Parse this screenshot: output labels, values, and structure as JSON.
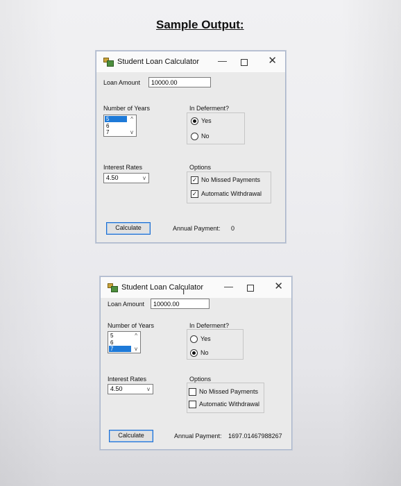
{
  "heading": "Sample Output:",
  "windows": [
    {
      "title": "Student Loan Calculator",
      "controls": {
        "minimize": "—",
        "maximize": "",
        "close": "✕"
      },
      "loan_amount_label": "Loan Amount",
      "loan_amount_value": "10000.00",
      "years_label": "Number of Years",
      "years_items": [
        "5",
        "6",
        "7"
      ],
      "years_selected": "5",
      "scroll_up": "^",
      "scroll_down": "v",
      "deferment_label": "In Deferment?",
      "deferment_yes": "Yes",
      "deferment_no": "No",
      "deferment_selected": "Yes",
      "rates_label": "Interest Rates",
      "rates_value": "4.50",
      "dropdown_arrow": "v",
      "options_label": "Options",
      "option_no_missed": "No Missed Payments",
      "option_auto": "Automatic Withdrawal",
      "option_no_missed_checked": true,
      "option_auto_checked": true,
      "calculate_label": "Calculate",
      "annual_payment_label": "Annual Payment:",
      "annual_payment_value": "0"
    },
    {
      "title": "Student Loan Calculator",
      "controls": {
        "minimize": "—",
        "maximize": "",
        "close": "✕"
      },
      "loan_amount_label": "Loan Amount",
      "loan_amount_value": "10000.00",
      "years_label": "Number of Years",
      "years_items": [
        "5",
        "6",
        "7"
      ],
      "years_selected": "7",
      "scroll_up": "^",
      "scroll_down": "v",
      "deferment_label": "In Deferment?",
      "deferment_yes": "Yes",
      "deferment_no": "No",
      "deferment_selected": "No",
      "rates_label": "Interest Rates",
      "rates_value": "4.50",
      "dropdown_arrow": "v",
      "options_label": "Options",
      "option_no_missed": "No Missed Payments",
      "option_auto": "Automatic Withdrawal",
      "option_no_missed_checked": false,
      "option_auto_checked": false,
      "calculate_label": "Calculate",
      "annual_payment_label": "Annual Payment:",
      "annual_payment_value": "1697.01467988267"
    }
  ],
  "colors": {
    "selection": "#1e7ad8",
    "button_border": "#1b6dd1"
  },
  "icons": {
    "app": "app-icon",
    "cursor": "text-cursor-icon"
  }
}
